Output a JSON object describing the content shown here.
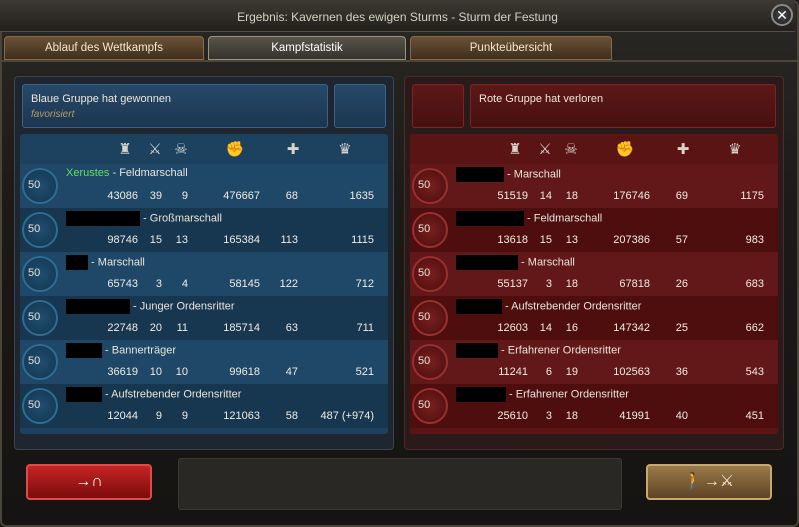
{
  "window": {
    "title": "Ergebnis: Kavernen des ewigen Sturms - Sturm der Festung",
    "close": "✕"
  },
  "tabs": [
    {
      "label": "Ablauf des Wettkampfs"
    },
    {
      "label": "Kampfstatistik"
    },
    {
      "label": "Punkteübersicht"
    }
  ],
  "blue": {
    "status": "Blaue Gruppe hat gewonnen",
    "sub": "favorisiert",
    "rows": [
      {
        "level": "50",
        "name": "Xerustes",
        "rank": "Feldmarschall",
        "c1": "43086",
        "c2": "39",
        "c3": "9",
        "c4": "476667",
        "c5": "68",
        "c6": "1635"
      },
      {
        "level": "50",
        "name": "",
        "rank": "Großmarschall",
        "c1": "98746",
        "c2": "15",
        "c3": "13",
        "c4": "165384",
        "c5": "113",
        "c6": "1115"
      },
      {
        "level": "50",
        "name": "",
        "rank": "Marschall",
        "c1": "65743",
        "c2": "3",
        "c3": "4",
        "c4": "58145",
        "c5": "122",
        "c6": "712"
      },
      {
        "level": "50",
        "name": "",
        "rank": "Junger Ordensritter",
        "c1": "22748",
        "c2": "20",
        "c3": "11",
        "c4": "185714",
        "c5": "63",
        "c6": "711"
      },
      {
        "level": "50",
        "name": "",
        "rank": "Bannerträger",
        "c1": "36619",
        "c2": "10",
        "c3": "10",
        "c4": "99618",
        "c5": "47",
        "c6": "521"
      },
      {
        "level": "50",
        "name": "",
        "rank": "Aufstrebender Ordensritter",
        "c1": "12044",
        "c2": "9",
        "c3": "9",
        "c4": "121063",
        "c5": "58",
        "c6": "487 (+974)"
      }
    ]
  },
  "red": {
    "status": "Rote Gruppe hat verloren",
    "rows": [
      {
        "level": "50",
        "name": "",
        "rank": "Marschall",
        "c1": "51519",
        "c2": "14",
        "c3": "18",
        "c4": "176746",
        "c5": "69",
        "c6": "1175"
      },
      {
        "level": "50",
        "name": "",
        "rank": "Feldmarschall",
        "c1": "13618",
        "c2": "15",
        "c3": "13",
        "c4": "207386",
        "c5": "57",
        "c6": "983"
      },
      {
        "level": "50",
        "name": "",
        "rank": "Marschall",
        "c1": "55137",
        "c2": "3",
        "c3": "18",
        "c4": "67818",
        "c5": "26",
        "c6": "683"
      },
      {
        "level": "50",
        "name": "",
        "rank": "Aufstrebender Ordensritter",
        "c1": "12603",
        "c2": "14",
        "c3": "16",
        "c4": "147342",
        "c5": "25",
        "c6": "662"
      },
      {
        "level": "50",
        "name": "",
        "rank": "Erfahrener Ordensritter",
        "c1": "11241",
        "c2": "6",
        "c3": "19",
        "c4": "102563",
        "c5": "36",
        "c6": "543"
      },
      {
        "level": "50",
        "name": "",
        "rank": "Erfahrener Ordensritter",
        "c1": "25610",
        "c2": "3",
        "c3": "18",
        "c4": "41991",
        "c5": "40",
        "c6": "451"
      }
    ]
  },
  "column_icons": [
    "tower-icon",
    "crossed-swords-icon",
    "skull-icon",
    "fist-icon",
    "plus-icon",
    "crown-icon"
  ],
  "buttons": {
    "leave": "→∩",
    "join": "🚶→⚔"
  }
}
